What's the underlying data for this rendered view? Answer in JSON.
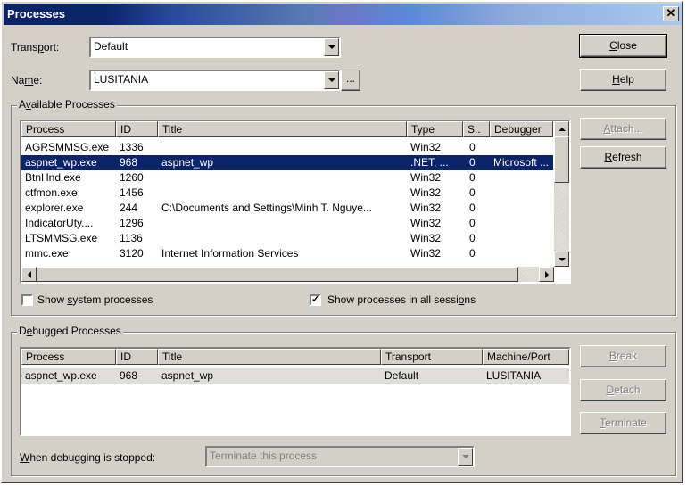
{
  "window": {
    "title": "Processes",
    "close_glyph": "✕"
  },
  "transport": {
    "label_pre": "Trans",
    "label_u": "p",
    "label_post": "ort:",
    "value": "Default"
  },
  "name": {
    "label_pre": "Na",
    "label_u": "m",
    "label_post": "e:",
    "value": "LUSITANIA",
    "browse_label": "..."
  },
  "buttons": {
    "close_u": "C",
    "close_rest": "lose",
    "help_u": "H",
    "help_rest": "elp",
    "attach_u": "A",
    "attach_rest": "ttach...",
    "refresh_u": "R",
    "refresh_rest": "efresh",
    "break_u": "B",
    "break_rest": "reak",
    "detach_u": "D",
    "detach_rest": "etach",
    "terminate_u": "T",
    "terminate_rest": "erminate"
  },
  "available": {
    "group_pre": "A",
    "group_u": "v",
    "group_post": "ailable Processes",
    "columns": [
      "Process",
      "ID",
      "Title",
      "Type",
      "S..",
      "Debugger"
    ],
    "rows": [
      {
        "process": "AGRSMMSG.exe",
        "id": "1336",
        "title": "",
        "type": "Win32",
        "s": "0",
        "debugger": ""
      },
      {
        "process": "aspnet_wp.exe",
        "id": "968",
        "title": "aspnet_wp",
        "type": ".NET, ...",
        "s": "0",
        "debugger": "Microsoft ..."
      },
      {
        "process": "BtnHnd.exe",
        "id": "1260",
        "title": "",
        "type": "Win32",
        "s": "0",
        "debugger": ""
      },
      {
        "process": "ctfmon.exe",
        "id": "1456",
        "title": "",
        "type": "Win32",
        "s": "0",
        "debugger": ""
      },
      {
        "process": "explorer.exe",
        "id": "244",
        "title": "C:\\Documents and Settings\\Minh T. Nguye...",
        "type": "Win32",
        "s": "0",
        "debugger": ""
      },
      {
        "process": "IndicatorUty....",
        "id": "1296",
        "title": "",
        "type": "Win32",
        "s": "0",
        "debugger": ""
      },
      {
        "process": "LTSMMSG.exe",
        "id": "1136",
        "title": "",
        "type": "Win32",
        "s": "0",
        "debugger": ""
      },
      {
        "process": "mmc.exe",
        "id": "3120",
        "title": "Internet Information Services",
        "type": "Win32",
        "s": "0",
        "debugger": ""
      }
    ],
    "show_system_pre": "Show ",
    "show_system_u": "s",
    "show_system_post": "ystem processes",
    "show_all_pre": "Show processes in all sessi",
    "show_all_u": "o",
    "show_all_post": "ns",
    "show_system_checked": false,
    "show_all_checked": true
  },
  "debugged": {
    "group_pre": "D",
    "group_u": "e",
    "group_post": "bugged Processes",
    "columns": [
      "Process",
      "ID",
      "Title",
      "Transport",
      "Machine/Port"
    ],
    "rows": [
      {
        "process": "aspnet_wp.exe",
        "id": "968",
        "title": "aspnet_wp",
        "transport": "Default",
        "machine": "LUSITANIA"
      }
    ]
  },
  "when_stopped": {
    "label_pre": "",
    "label_u": "W",
    "label_post": "hen debugging is stopped:",
    "value": "Terminate this process"
  },
  "colors": {
    "selection": "#0a246a",
    "face": "#d4d0c8"
  }
}
